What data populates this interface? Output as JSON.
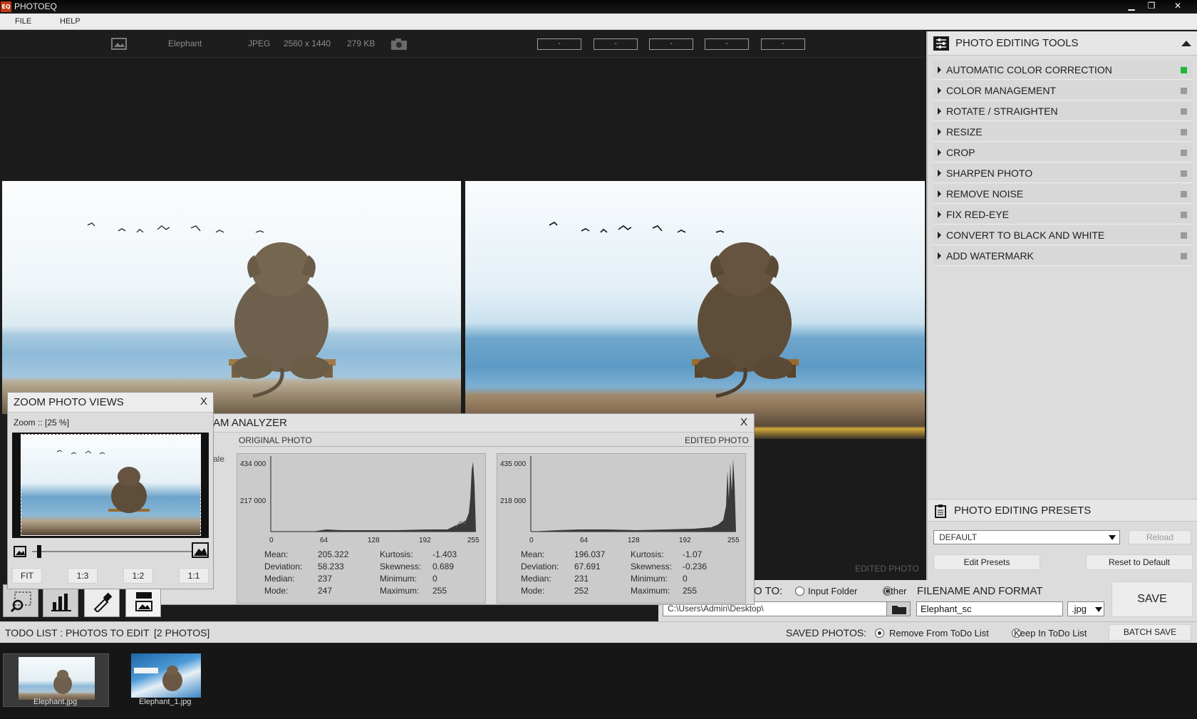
{
  "app": {
    "title": "PHOTOEQ",
    "logo_text": "EQ"
  },
  "menu": {
    "file": "FILE",
    "help": "HELP"
  },
  "window_buttons": {
    "minimize": "▁",
    "restore": "❐",
    "close": "✕"
  },
  "info": {
    "name": "Elephant",
    "format": "JPEG",
    "dimensions": "2560 x 1440",
    "size": "279 KB",
    "slots": [
      "-",
      "-",
      "-",
      "-",
      "-"
    ]
  },
  "edited_photo_label": "EDITED PHOTO",
  "tools_panel": {
    "title": "PHOTO EDITING TOOLS",
    "items": [
      {
        "label": "AUTOMATIC COLOR CORRECTION",
        "active": true,
        "indicator": "#1fb83a"
      },
      {
        "label": "COLOR MANAGEMENT",
        "active": false
      },
      {
        "label": "ROTATE / STRAIGHTEN",
        "active": false
      },
      {
        "label": "RESIZE",
        "active": false
      },
      {
        "label": "CROP",
        "active": false
      },
      {
        "label": "SHARPEN PHOTO",
        "active": false
      },
      {
        "label": "REMOVE NOISE",
        "active": false
      },
      {
        "label": "FIX RED-EYE",
        "active": false
      },
      {
        "label": "CONVERT TO BLACK AND WHITE",
        "active": false
      },
      {
        "label": "ADD WATERMARK",
        "active": false
      }
    ]
  },
  "presets_panel": {
    "title": "PHOTO EDITING PRESETS",
    "selected": "DEFAULT",
    "reload": "Reload",
    "edit": "Edit Presets",
    "reset": "Reset to Default"
  },
  "save_area": {
    "to_label": "O TO:",
    "input_folder": "Input Folder",
    "other": "Other",
    "path": "C:\\Users\\Admin\\Desktop\\",
    "filename_title": "FILENAME AND FORMAT",
    "filename": "Elephant_sc",
    "format": ".jpg",
    "save": "SAVE"
  },
  "todo": {
    "title": "TODO LIST : PHOTOS TO EDIT",
    "count": "[2 PHOTOS]",
    "saved_photos": "SAVED PHOTOS:",
    "remove_option": "Remove From ToDo List",
    "keep_option": "Keep In ToDo List",
    "batch_save": "BATCH SAVE",
    "thumbs": [
      "Elephant.jpg",
      "Elephant_1.jpg"
    ]
  },
  "zoom_panel": {
    "title": "ZOOM PHOTO VIEWS",
    "close": "X",
    "zoom_text": "Zoom :: [25 %]",
    "buttons": [
      "FIT",
      "1:3",
      "1:2",
      "1:1"
    ],
    "slider_value": 0.03
  },
  "histogram_panel": {
    "title": "AM ANALYZER",
    "close": "X",
    "partial_label": "ale",
    "original_label": "ORIGINAL PHOTO",
    "edited_label": "EDITED PHOTO",
    "original": {
      "ymax": "434 000",
      "ymid": "217 000",
      "xticks": [
        "0",
        "64",
        "128",
        "192",
        "255"
      ],
      "mean_label": "Mean:",
      "mean": "205.322",
      "dev_label": "Deviation:",
      "dev": "58.233",
      "median_label": "Median:",
      "median": "237",
      "mode_label": "Mode:",
      "mode": "247",
      "kurt_label": "Kurtosis:",
      "kurt": "-1.403",
      "skew_label": "Skewness:",
      "skew": "0.689",
      "min_label": "Minimum:",
      "min": "0",
      "max_label": "Maximum:",
      "max": "255"
    },
    "edited": {
      "ymax": "435 000",
      "ymid": "218 000",
      "xticks": [
        "0",
        "64",
        "128",
        "192",
        "255"
      ],
      "mean_label": "Mean:",
      "mean": "196.037",
      "dev_label": "Deviation:",
      "dev": "67.691",
      "median_label": "Median:",
      "median": "231",
      "mode_label": "Mode:",
      "mode": "252",
      "kurt_label": "Kurtosis:",
      "kurt": "-1.07",
      "skew_label": "Skewness:",
      "skew": "-0.236",
      "min_label": "Minimum:",
      "min": "0",
      "max_label": "Maximum:",
      "max": "255"
    }
  }
}
